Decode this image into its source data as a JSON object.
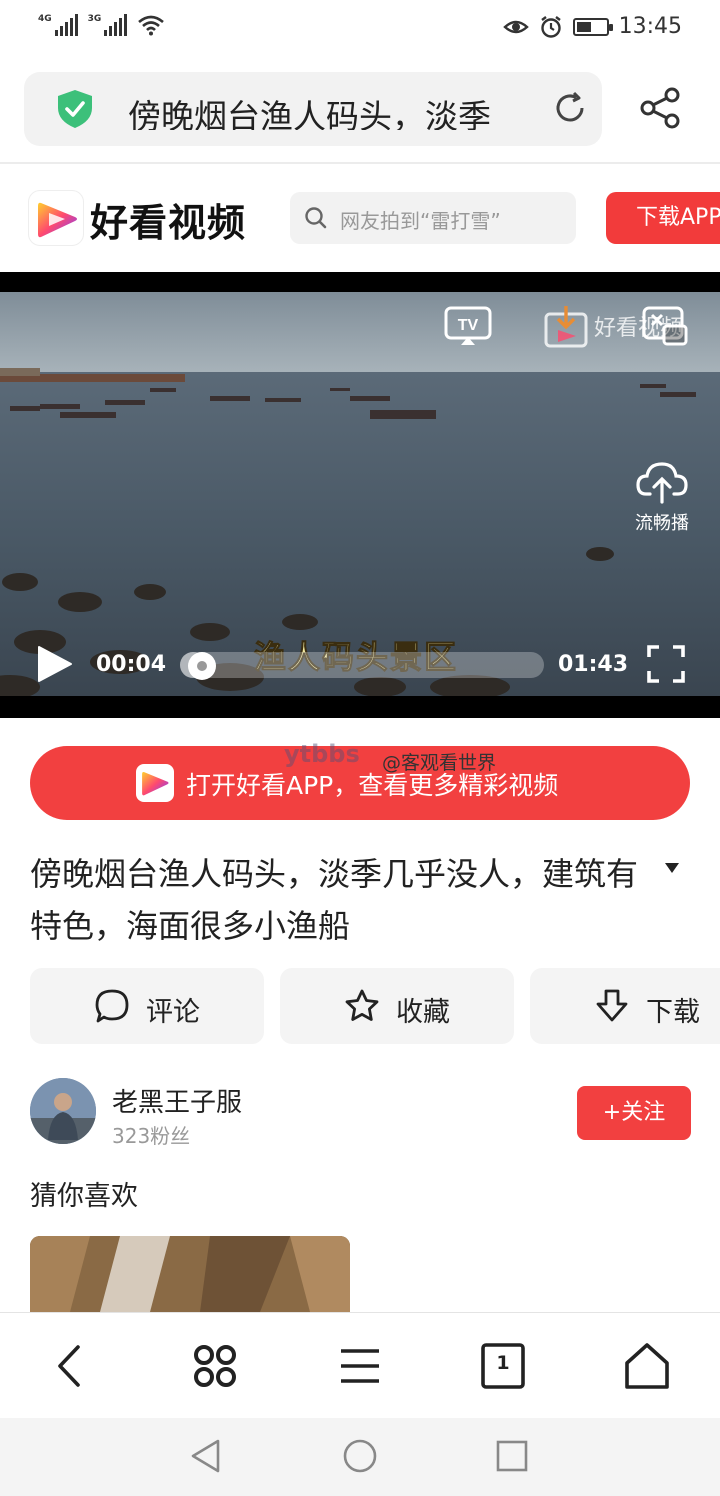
{
  "status_bar": {
    "network_1": "4G",
    "network_2": "3G",
    "time": "13:45",
    "icons": [
      "signal-4g-icon",
      "signal-3g-icon",
      "wifi-icon",
      "eye-comfort-icon",
      "alarm-icon",
      "battery-icon"
    ],
    "battery_level": 0.5
  },
  "address_bar": {
    "url_text": "傍晚烟台渔人码头，淡季",
    "icons": [
      "secure-shield-icon",
      "reload-icon",
      "share-icon"
    ]
  },
  "site_header": {
    "logo_text": "好看视频",
    "search_placeholder": "网友拍到“雷打雪”",
    "download_button": "下载APP"
  },
  "video": {
    "watermark": "好看视频",
    "smooth_label": "流畅播",
    "subtitle": "渔人码头景区",
    "current_time": "00:04",
    "total_time": "01:43",
    "progress": 0.04
  },
  "open_app_banner": {
    "label": "打开好看APP，查看更多精彩视频"
  },
  "overlay_watermark": {
    "site": "ytbbs",
    "user": "@客观看世界"
  },
  "video_title": "傍晚烟台渔人码头，淡季几乎没人，建筑有特色，海面很多小渔船",
  "actions": {
    "comment": "评论",
    "favorite": "收藏",
    "download": "下载"
  },
  "author": {
    "name": "老黑王子服",
    "fans": "323粉丝",
    "follow_button": "+关注"
  },
  "recommend": {
    "heading": "猜你喜欢"
  },
  "toolbar": {
    "tab_count": "1",
    "icons": [
      "back-icon",
      "multi-window-icon",
      "menu-icon",
      "tabs-icon",
      "home-icon"
    ]
  },
  "android_nav": {
    "icons": [
      "nav-back-icon",
      "nav-home-icon",
      "nav-recents-icon"
    ]
  },
  "colors": {
    "brand_red": "#f23b3b",
    "shield_green": "#3cc07a"
  }
}
